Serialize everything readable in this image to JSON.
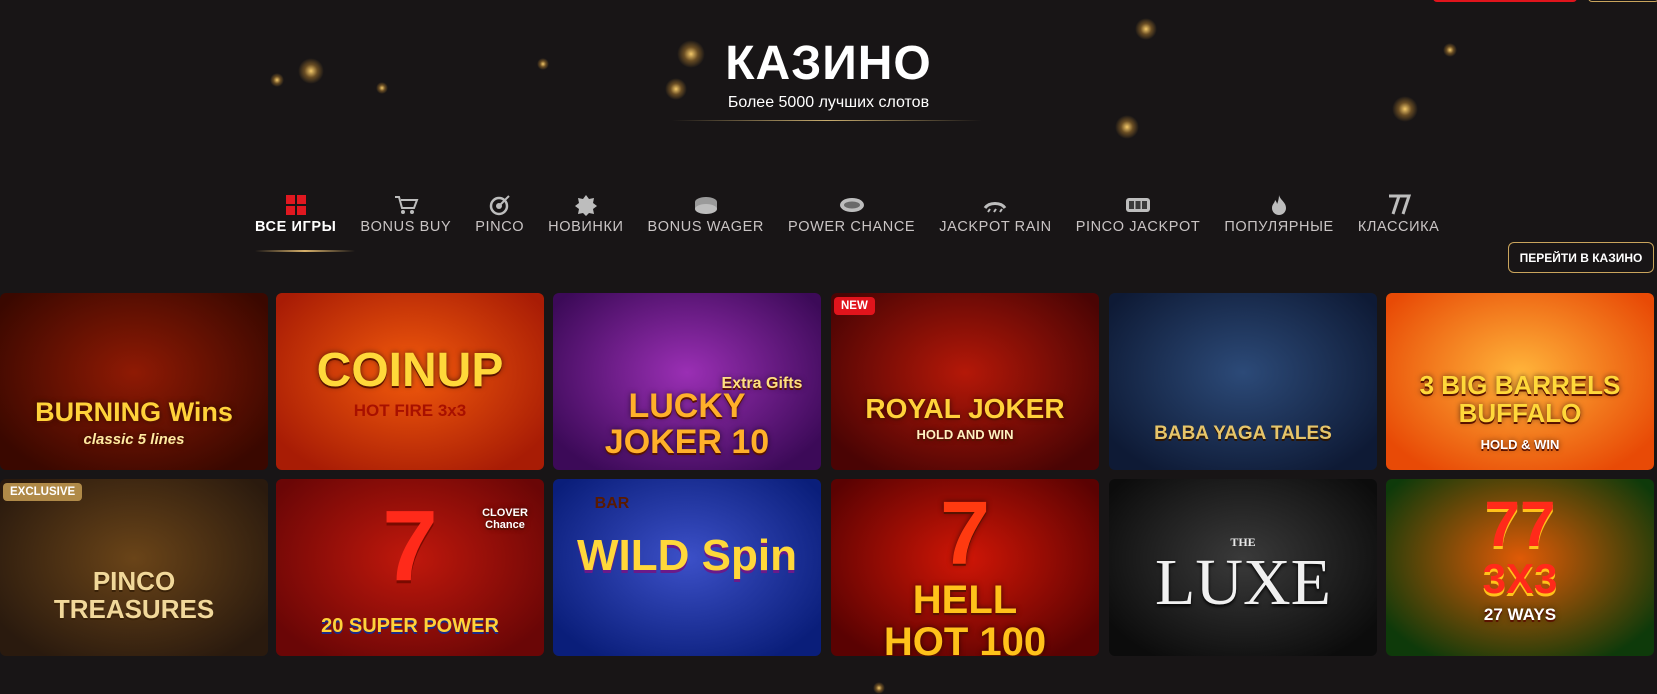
{
  "hero": {
    "title": "КАЗИНО",
    "subtitle": "Более 5000 лучших слотов"
  },
  "nav": {
    "items": [
      {
        "label": "ВСЕ ИГРЫ",
        "icon": "grid-icon",
        "active": true
      },
      {
        "label": "BONUS BUY",
        "icon": "bonus-buy-cart-icon",
        "active": false
      },
      {
        "label": "PINCO",
        "icon": "pinco-target-icon",
        "active": false
      },
      {
        "label": "НОВИНКИ",
        "icon": "new-badge-icon",
        "active": false
      },
      {
        "label": "BONUS WAGER",
        "icon": "bonus-wager-icon",
        "active": false
      },
      {
        "label": "POWER CHANCE",
        "icon": "power-chance-icon",
        "active": false
      },
      {
        "label": "JACKPOT RAIN",
        "icon": "jackpot-rain-icon",
        "active": false
      },
      {
        "label": "PINCO JACKPOT",
        "icon": "pinco-jackpot-icon",
        "active": false
      },
      {
        "label": "ПОПУЛЯРНЫЕ",
        "icon": "fire-icon",
        "active": false
      },
      {
        "label": "КЛАССИКА",
        "icon": "seven-icon",
        "active": false
      }
    ]
  },
  "goto_casino_label": "ПЕРЕЙТИ В КАЗИНО",
  "games": [
    {
      "title": "BURNING Wins",
      "subtitle": "classic 5 lines",
      "badge": "",
      "colors": [
        "#3a0800",
        "#8f1a04"
      ]
    },
    {
      "title": "COINUP",
      "subtitle": "HOT FIRE 3x3",
      "badge": "",
      "colors": [
        "#a81c05",
        "#f25a0c"
      ]
    },
    {
      "title": "LUCKY JOKER 10",
      "subtitle": "Extra Gifts",
      "badge": "",
      "colors": [
        "#3c0a58",
        "#9a2fb4"
      ]
    },
    {
      "title": "ROYAL JOKER",
      "subtitle": "HOLD AND WIN",
      "badge": "NEW",
      "colors": [
        "#4a0404",
        "#b41808"
      ]
    },
    {
      "title": "BABA YAGA TALES",
      "subtitle": "",
      "badge": "",
      "colors": [
        "#0e1a35",
        "#2c4a78"
      ]
    },
    {
      "title": "3 BIG BARRELS BUFFALO",
      "subtitle": "HOLD & WIN",
      "badge": "",
      "colors": [
        "#e84a06",
        "#ffb43a"
      ]
    },
    {
      "title": "PINCO TREASURES",
      "subtitle": "",
      "badge": "EXCLUSIVE",
      "colors": [
        "#2a1a0e",
        "#6a4418"
      ]
    },
    {
      "title": "20 SUPER POWER",
      "subtitle": "CLOVER Chance",
      "badge": "",
      "colors": [
        "#6a0606",
        "#c0180c"
      ]
    },
    {
      "title": "WILD Spin",
      "subtitle": "BAR",
      "badge": "",
      "colors": [
        "#0a1e7a",
        "#3c50c8"
      ]
    },
    {
      "title": "HELL HOT 100",
      "subtitle": "",
      "badge": "",
      "colors": [
        "#5a0202",
        "#d01606"
      ]
    },
    {
      "title": "LUXE",
      "subtitle": "THE",
      "badge": "",
      "colors": [
        "#0c0c0c",
        "#3a3a3a"
      ]
    },
    {
      "title": "3X3",
      "subtitle": "27 WAYS",
      "badge": "",
      "colors": [
        "#0e3a0a",
        "#e05a06"
      ]
    }
  ],
  "colors": {
    "background": "#181516",
    "accent_gold": "#c9a45c",
    "badge_new": "#e0141c",
    "badge_exclusive": "#b08a48"
  }
}
